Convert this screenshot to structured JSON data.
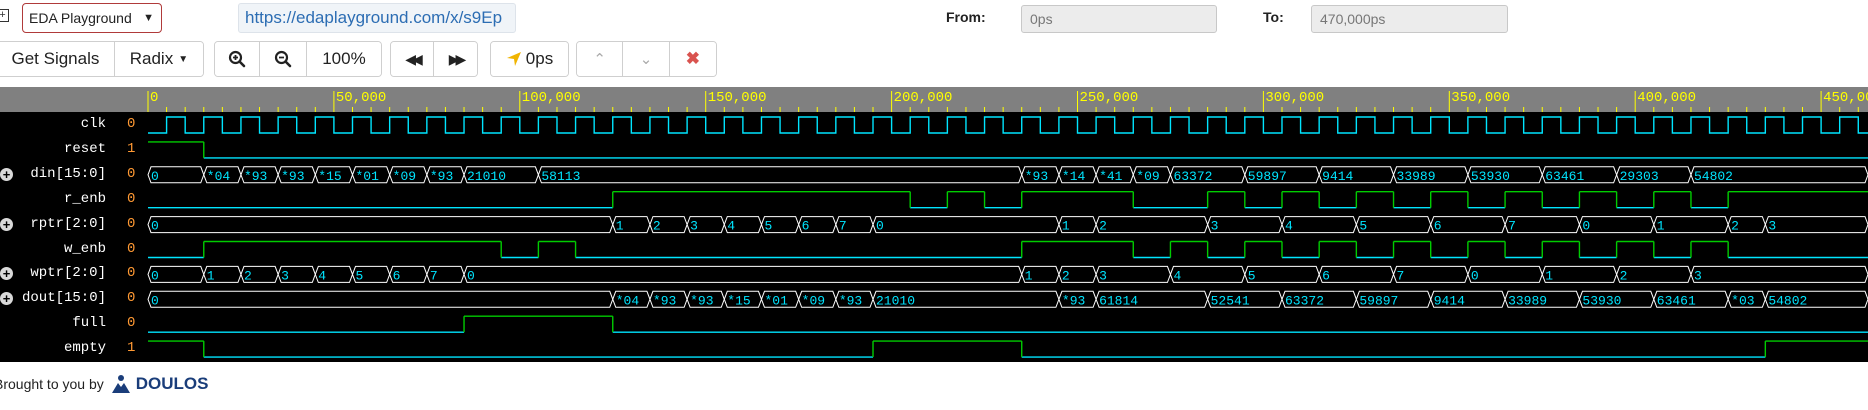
{
  "top": {
    "expand_symbol": "+",
    "source_select": "EDA Playground",
    "share_url": "https://edaplayground.com/x/s9Ep",
    "from_label": "From:",
    "from_value": "0ps",
    "to_label": "To:",
    "to_value": "470,000ps"
  },
  "toolbar": {
    "get_signals": "Get Signals",
    "radix": "Radix",
    "zoom_level": "100%",
    "cursor_time": "0ps"
  },
  "ruler": {
    "ticks": [
      "0",
      "50,000",
      "100,000",
      "150,000",
      "200,000",
      "250,000",
      "300,000",
      "350,000",
      "400,000",
      "450,000"
    ]
  },
  "signals": [
    {
      "name": "clk",
      "value": "0",
      "bus": false,
      "kind": "clock"
    },
    {
      "name": "reset",
      "value": "1",
      "bus": false,
      "kind": "bit",
      "changes": [
        [
          0,
          1
        ],
        [
          15000,
          0
        ]
      ]
    },
    {
      "name": "din[15:0]",
      "value": "0",
      "bus": true,
      "kind": "bus",
      "segments": [
        [
          0,
          "0"
        ],
        [
          15000,
          "*04"
        ],
        [
          25000,
          "*93"
        ],
        [
          35000,
          "*93"
        ],
        [
          45000,
          "*15"
        ],
        [
          55000,
          "*01"
        ],
        [
          65000,
          "*09"
        ],
        [
          75000,
          "*93"
        ],
        [
          85000,
          "21010"
        ],
        [
          105000,
          "58113"
        ],
        [
          235000,
          "*93"
        ],
        [
          245000,
          "*14"
        ],
        [
          255000,
          "*41"
        ],
        [
          265000,
          "*09"
        ],
        [
          275000,
          "63372"
        ],
        [
          295000,
          "59897"
        ],
        [
          315000,
          "9414"
        ],
        [
          335000,
          "33989"
        ],
        [
          355000,
          "53930"
        ],
        [
          375000,
          "63461"
        ],
        [
          395000,
          "29303"
        ],
        [
          415000,
          "54802"
        ]
      ]
    },
    {
      "name": "r_enb",
      "value": "0",
      "bus": false,
      "kind": "bit",
      "changes": [
        [
          0,
          0
        ],
        [
          125000,
          1
        ],
        [
          205000,
          0
        ],
        [
          215000,
          1
        ],
        [
          225000,
          0
        ],
        [
          235000,
          1
        ],
        [
          265000,
          0
        ],
        [
          285000,
          1
        ],
        [
          295000,
          0
        ],
        [
          305000,
          1
        ],
        [
          315000,
          0
        ],
        [
          325000,
          1
        ],
        [
          335000,
          0
        ],
        [
          345000,
          1
        ],
        [
          355000,
          0
        ],
        [
          365000,
          1
        ],
        [
          375000,
          0
        ],
        [
          385000,
          1
        ],
        [
          395000,
          0
        ],
        [
          405000,
          1
        ],
        [
          415000,
          0
        ],
        [
          425000,
          1
        ]
      ]
    },
    {
      "name": "rptr[2:0]",
      "value": "0",
      "bus": true,
      "kind": "bus",
      "segments": [
        [
          0,
          "0"
        ],
        [
          125000,
          "1"
        ],
        [
          135000,
          "2"
        ],
        [
          145000,
          "3"
        ],
        [
          155000,
          "4"
        ],
        [
          165000,
          "5"
        ],
        [
          175000,
          "6"
        ],
        [
          185000,
          "7"
        ],
        [
          195000,
          "0"
        ],
        [
          245000,
          "1"
        ],
        [
          255000,
          "2"
        ],
        [
          285000,
          "3"
        ],
        [
          305000,
          "4"
        ],
        [
          325000,
          "5"
        ],
        [
          345000,
          "6"
        ],
        [
          365000,
          "7"
        ],
        [
          385000,
          "0"
        ],
        [
          405000,
          "1"
        ],
        [
          425000,
          "2"
        ],
        [
          435000,
          "3"
        ]
      ]
    },
    {
      "name": "w_enb",
      "value": "0",
      "bus": false,
      "kind": "bit",
      "changes": [
        [
          0,
          0
        ],
        [
          15000,
          1
        ],
        [
          95000,
          0
        ],
        [
          105000,
          1
        ],
        [
          115000,
          0
        ],
        [
          235000,
          1
        ],
        [
          265000,
          0
        ],
        [
          275000,
          1
        ],
        [
          285000,
          0
        ],
        [
          295000,
          1
        ],
        [
          305000,
          0
        ],
        [
          315000,
          1
        ],
        [
          325000,
          0
        ],
        [
          335000,
          1
        ],
        [
          345000,
          0
        ],
        [
          355000,
          1
        ],
        [
          365000,
          0
        ],
        [
          375000,
          1
        ],
        [
          385000,
          0
        ],
        [
          395000,
          1
        ],
        [
          405000,
          0
        ],
        [
          415000,
          1
        ],
        [
          425000,
          0
        ]
      ]
    },
    {
      "name": "wptr[2:0]",
      "value": "0",
      "bus": true,
      "kind": "bus",
      "segments": [
        [
          0,
          "0"
        ],
        [
          15000,
          "1"
        ],
        [
          25000,
          "2"
        ],
        [
          35000,
          "3"
        ],
        [
          45000,
          "4"
        ],
        [
          55000,
          "5"
        ],
        [
          65000,
          "6"
        ],
        [
          75000,
          "7"
        ],
        [
          85000,
          "0"
        ],
        [
          235000,
          "1"
        ],
        [
          245000,
          "2"
        ],
        [
          255000,
          "3"
        ],
        [
          275000,
          "4"
        ],
        [
          295000,
          "5"
        ],
        [
          315000,
          "6"
        ],
        [
          335000,
          "7"
        ],
        [
          355000,
          "0"
        ],
        [
          375000,
          "1"
        ],
        [
          395000,
          "2"
        ],
        [
          415000,
          "3"
        ]
      ]
    },
    {
      "name": "dout[15:0]",
      "value": "0",
      "bus": true,
      "kind": "bus",
      "segments": [
        [
          0,
          "0"
        ],
        [
          125000,
          "*04"
        ],
        [
          135000,
          "*93"
        ],
        [
          145000,
          "*93"
        ],
        [
          155000,
          "*15"
        ],
        [
          165000,
          "*01"
        ],
        [
          175000,
          "*09"
        ],
        [
          185000,
          "*93"
        ],
        [
          195000,
          "21010"
        ],
        [
          245000,
          "*93"
        ],
        [
          255000,
          "61814"
        ],
        [
          285000,
          "52541"
        ],
        [
          305000,
          "63372"
        ],
        [
          325000,
          "59897"
        ],
        [
          345000,
          "9414"
        ],
        [
          365000,
          "33989"
        ],
        [
          385000,
          "53930"
        ],
        [
          405000,
          "63461"
        ],
        [
          425000,
          "*03"
        ],
        [
          435000,
          "54802"
        ]
      ]
    },
    {
      "name": "full",
      "value": "0",
      "bus": false,
      "kind": "bit",
      "changes": [
        [
          0,
          0
        ],
        [
          85000,
          1
        ],
        [
          125000,
          0
        ]
      ]
    },
    {
      "name": "empty",
      "value": "1",
      "bus": false,
      "kind": "bit",
      "changes": [
        [
          0,
          1
        ],
        [
          15000,
          0
        ],
        [
          195000,
          1
        ],
        [
          235000,
          0
        ],
        [
          435000,
          1
        ]
      ]
    }
  ],
  "footer": {
    "text": "Brought to you by",
    "logo": "DOULOS"
  },
  "colors": {
    "trace_blue": "#00e5ff",
    "trace_green": "#00cc00",
    "value_orange": "#ff9933",
    "ruler_yellow": "#ffff00",
    "ruler_bg": "#808080",
    "wave_bg": "#000000"
  }
}
